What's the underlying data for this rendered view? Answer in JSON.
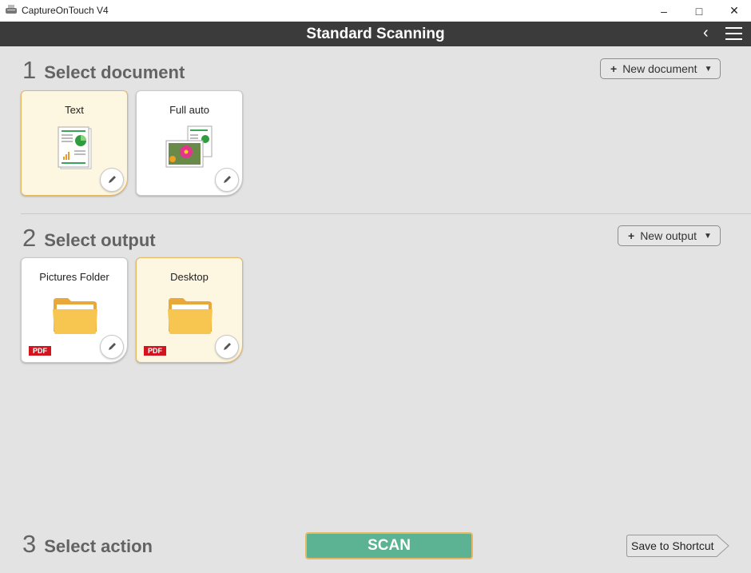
{
  "window": {
    "title": "CaptureOnTouch V4",
    "controls": {
      "minimize": "–",
      "maximize": "□",
      "close": "✕"
    }
  },
  "header": {
    "title": "Standard Scanning",
    "back_icon": "‹",
    "menu_icon": "hamburger-icon"
  },
  "step1": {
    "number": "1",
    "label": "Select document",
    "new_button": {
      "plus": "+",
      "label": "New document",
      "caret": "▼"
    },
    "cards": [
      {
        "name": "Text",
        "icon": "text-document-icon",
        "selected": true
      },
      {
        "name": "Full auto",
        "icon": "photo-document-icon",
        "selected": false
      }
    ]
  },
  "step2": {
    "number": "2",
    "label": "Select output",
    "new_button": {
      "plus": "+",
      "label": "New output",
      "caret": "▼"
    },
    "cards": [
      {
        "name": "Pictures Folder",
        "icon": "folder-icon",
        "badge": "PDF",
        "selected": false
      },
      {
        "name": "Desktop",
        "icon": "folder-icon",
        "badge": "PDF",
        "selected": true
      }
    ]
  },
  "step3": {
    "number": "3",
    "label": "Select action",
    "scan_label": "SCAN",
    "shortcut_label": "Save to Shortcut"
  },
  "colors": {
    "header_bg": "#3b3b3b",
    "selected_card_bg": "#fdf6e1",
    "selected_border": "#e6b864",
    "scan_green": "#5bb393",
    "pdf_red": "#d2141e"
  }
}
